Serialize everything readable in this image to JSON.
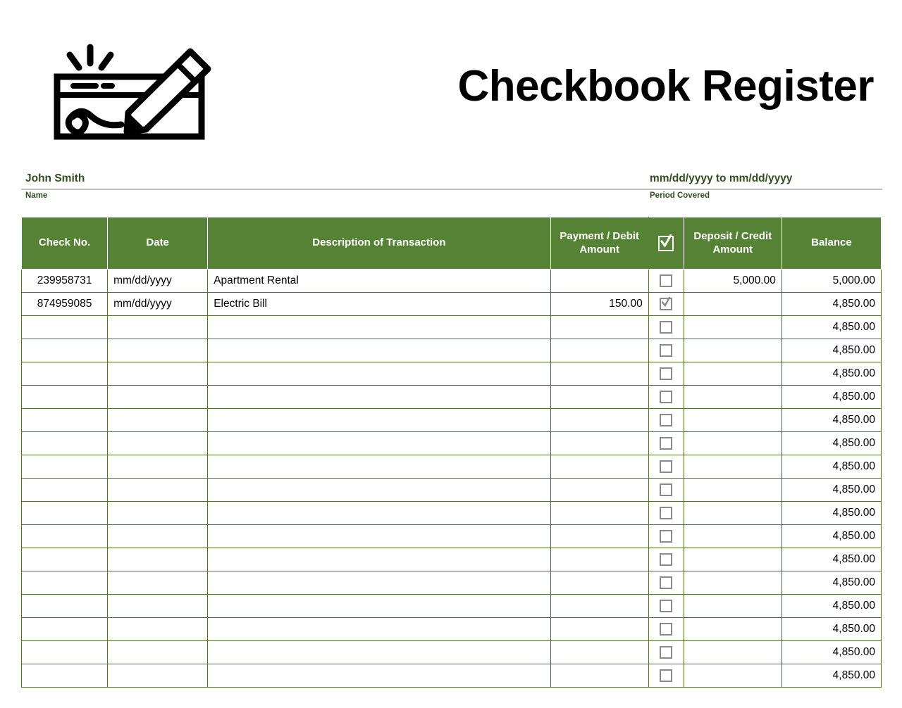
{
  "header": {
    "title": "Checkbook Register",
    "logo_icon": "check-with-pencil-icon"
  },
  "meta": {
    "name": {
      "value": "John Smith",
      "label": "Name"
    },
    "period": {
      "value": "mm/dd/yyyy to mm/dd/yyyy",
      "label": "Period Covered"
    }
  },
  "colors": {
    "header_green": "#558234",
    "grid_green": "#4e7334",
    "meta_text_green": "#2f4f1e",
    "rule_gray": "#bfbfbf",
    "checkbox_gray": "#8a8a8a"
  },
  "table": {
    "columns": [
      "Check No.",
      "Date",
      "Description of Transaction",
      "Payment / Debit Amount",
      "",
      "Deposit / Credit Amount",
      "Balance"
    ],
    "cleared_header_icon": "checked-checkbox-icon",
    "rows": [
      {
        "check_no": "239958731",
        "date": "mm/dd/yyyy",
        "description": "Apartment Rental",
        "payment": "",
        "cleared": false,
        "deposit": "5,000.00",
        "balance": "5,000.00"
      },
      {
        "check_no": "874959085",
        "date": "mm/dd/yyyy",
        "description": "Electric Bill",
        "payment": "150.00",
        "cleared": true,
        "deposit": "",
        "balance": "4,850.00"
      },
      {
        "check_no": "",
        "date": "",
        "description": "",
        "payment": "",
        "cleared": false,
        "deposit": "",
        "balance": "4,850.00"
      },
      {
        "check_no": "",
        "date": "",
        "description": "",
        "payment": "",
        "cleared": false,
        "deposit": "",
        "balance": "4,850.00"
      },
      {
        "check_no": "",
        "date": "",
        "description": "",
        "payment": "",
        "cleared": false,
        "deposit": "",
        "balance": "4,850.00"
      },
      {
        "check_no": "",
        "date": "",
        "description": "",
        "payment": "",
        "cleared": false,
        "deposit": "",
        "balance": "4,850.00"
      },
      {
        "check_no": "",
        "date": "",
        "description": "",
        "payment": "",
        "cleared": false,
        "deposit": "",
        "balance": "4,850.00"
      },
      {
        "check_no": "",
        "date": "",
        "description": "",
        "payment": "",
        "cleared": false,
        "deposit": "",
        "balance": "4,850.00"
      },
      {
        "check_no": "",
        "date": "",
        "description": "",
        "payment": "",
        "cleared": false,
        "deposit": "",
        "balance": "4,850.00"
      },
      {
        "check_no": "",
        "date": "",
        "description": "",
        "payment": "",
        "cleared": false,
        "deposit": "",
        "balance": "4,850.00"
      },
      {
        "check_no": "",
        "date": "",
        "description": "",
        "payment": "",
        "cleared": false,
        "deposit": "",
        "balance": "4,850.00"
      },
      {
        "check_no": "",
        "date": "",
        "description": "",
        "payment": "",
        "cleared": false,
        "deposit": "",
        "balance": "4,850.00"
      },
      {
        "check_no": "",
        "date": "",
        "description": "",
        "payment": "",
        "cleared": false,
        "deposit": "",
        "balance": "4,850.00"
      },
      {
        "check_no": "",
        "date": "",
        "description": "",
        "payment": "",
        "cleared": false,
        "deposit": "",
        "balance": "4,850.00"
      },
      {
        "check_no": "",
        "date": "",
        "description": "",
        "payment": "",
        "cleared": false,
        "deposit": "",
        "balance": "4,850.00"
      },
      {
        "check_no": "",
        "date": "",
        "description": "",
        "payment": "",
        "cleared": false,
        "deposit": "",
        "balance": "4,850.00"
      },
      {
        "check_no": "",
        "date": "",
        "description": "",
        "payment": "",
        "cleared": false,
        "deposit": "",
        "balance": "4,850.00"
      },
      {
        "check_no": "",
        "date": "",
        "description": "",
        "payment": "",
        "cleared": false,
        "deposit": "",
        "balance": "4,850.00"
      }
    ]
  }
}
